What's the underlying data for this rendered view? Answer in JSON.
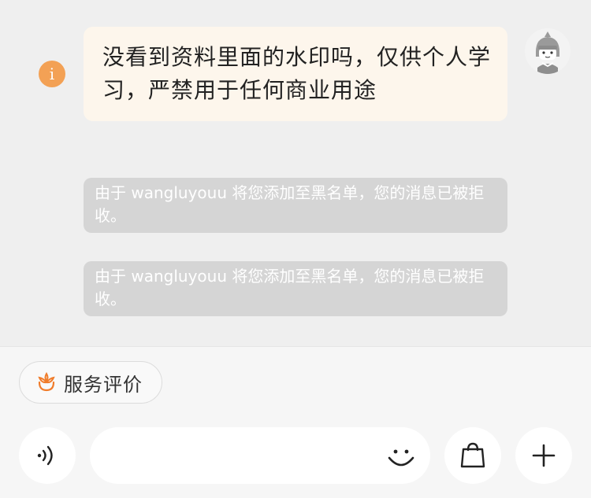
{
  "chat": {
    "info_icon_glyph": "i",
    "message_text": "没看到资料里面的水印吗，仅供个人学习，严禁用于任何商业用途",
    "system_messages": [
      "由于 wangluyouu 将您添加至黑名单，您的消息已被拒收。",
      "由于 wangluyouu 将您添加至黑名单，您的消息已被拒收。"
    ]
  },
  "bottom": {
    "service_rating_label": "服务评价",
    "input_placeholder": ""
  },
  "colors": {
    "accent_orange": "#f3a155",
    "bubble_bg": "#fdf6ec",
    "system_bg": "#d5d5d5"
  },
  "icons": {
    "voice": "voice-icon",
    "emoji": "emoji-icon",
    "bag": "shopping-bag-icon",
    "plus": "plus-icon",
    "flower": "flower-icon",
    "avatar": "avatar"
  }
}
